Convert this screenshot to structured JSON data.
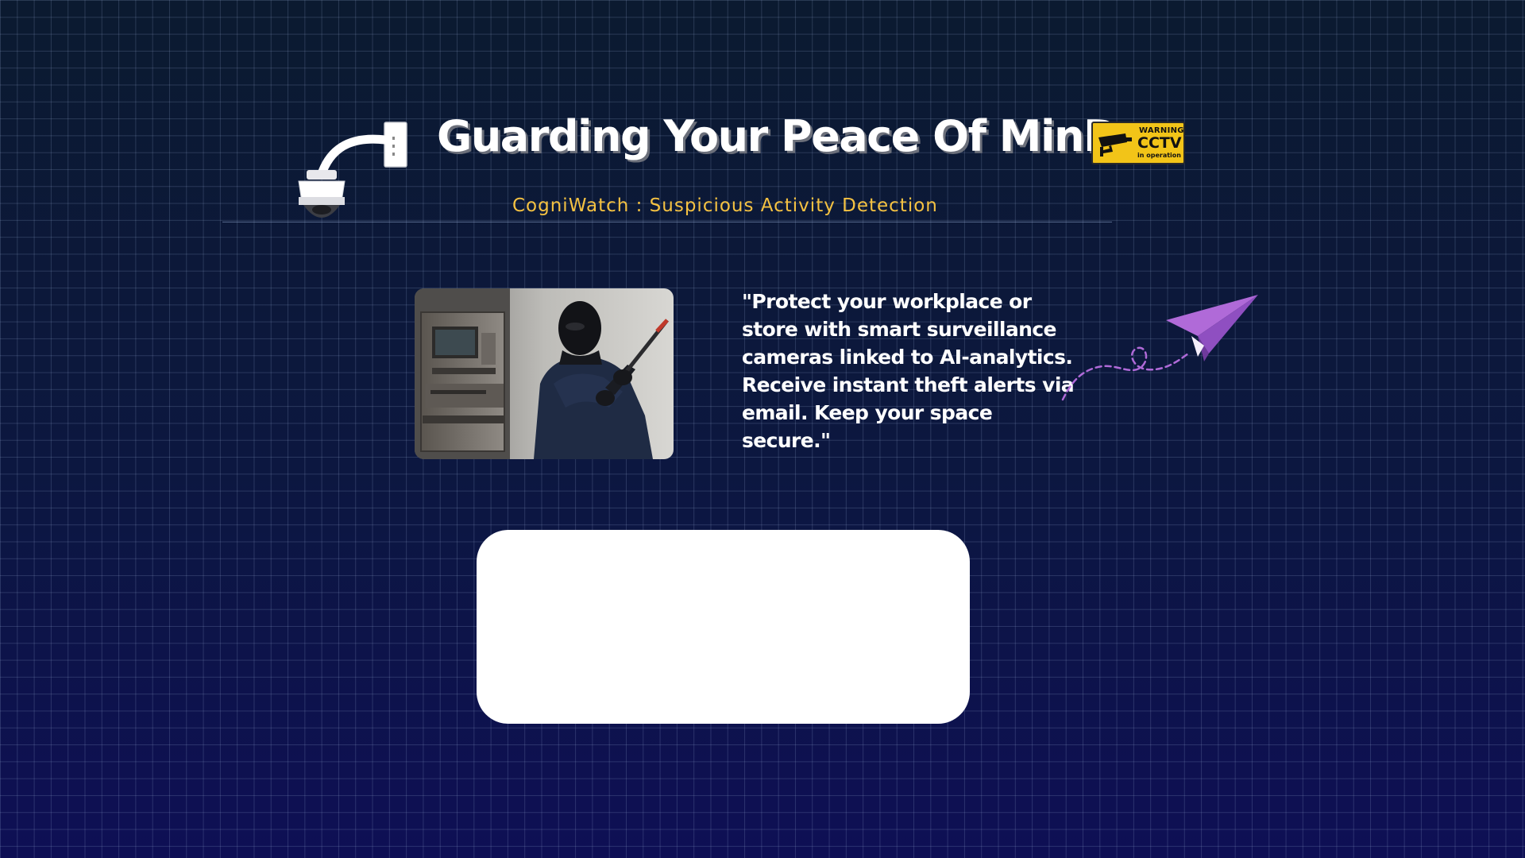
{
  "header": {
    "title": "Guarding Your Peace Of MinD",
    "subtitle": "CogniWatch : Suspicious Activity Detection"
  },
  "sign": {
    "warning": "WARNING",
    "cctv": "CCTV",
    "operation": "in operation"
  },
  "hero": {
    "quote": "\"Protect your workplace or store with smart surveillance cameras linked to AI-analytics. Receive instant theft alerts via email. Keep your space secure.\""
  },
  "icons": {
    "camera": "security-camera-icon",
    "sign": "cctv-warning-sign-icon",
    "plane": "paper-plane-icon"
  },
  "colors": {
    "background": "#0a1330",
    "subtitle": "#f5c242",
    "sign": "#f2c418",
    "plane": "#b06ad8",
    "panel": "#ffffff"
  }
}
